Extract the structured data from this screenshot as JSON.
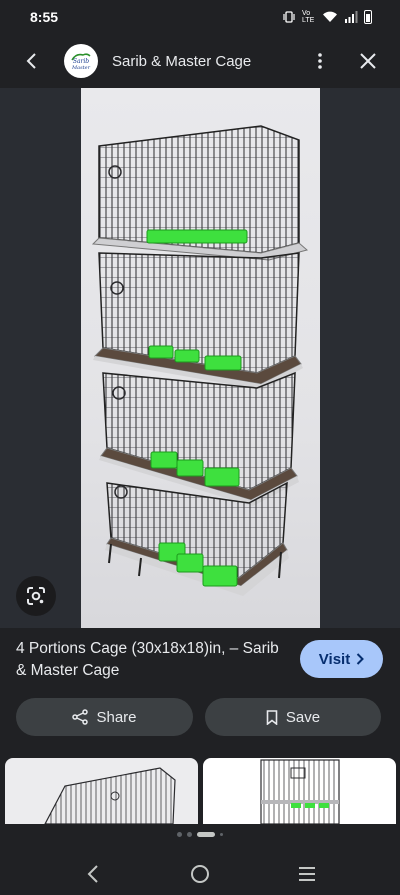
{
  "status_bar": {
    "time": "8:55",
    "network_label": "Vo LTE"
  },
  "app_bar": {
    "site_name": "Sarib & Master Cage",
    "logo_text": "Sarib Master Cage",
    "back_icon": "back-arrow-icon",
    "more_icon": "more-vert-icon",
    "close_icon": "close-icon"
  },
  "image": {
    "alt": "4 portion bird cage with green feeders",
    "lens_icon": "google-lens-icon"
  },
  "result": {
    "title": "4 Portions Cage (30x18x18)in, – Sarib & Master Cage",
    "visit_label": "Visit",
    "share_label": "Share",
    "save_label": "Save"
  },
  "pager": {
    "dots": 4,
    "active_index": 2
  },
  "colors": {
    "background": "#202124",
    "visit_button": "#a8c7fa",
    "action_button": "#3c4043",
    "feeder_green": "#3ee03e"
  }
}
